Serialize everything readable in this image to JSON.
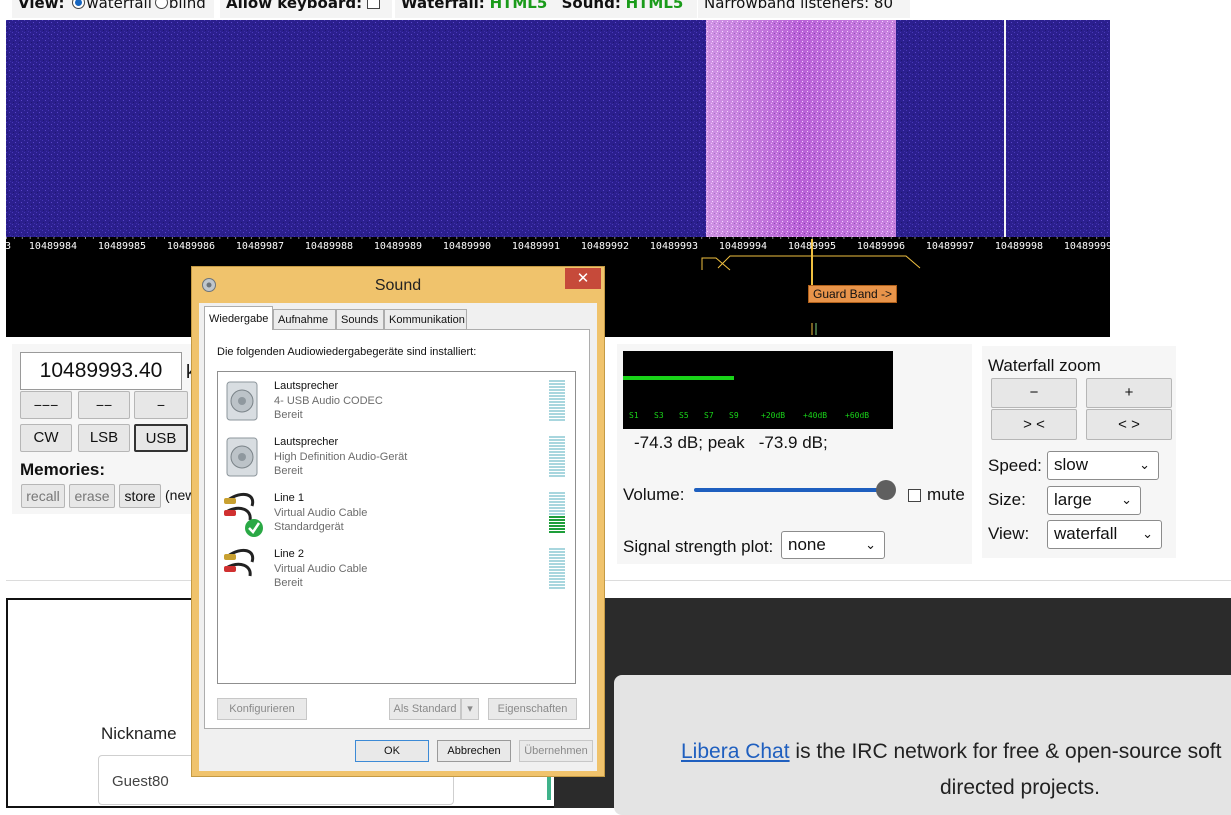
{
  "topbar": {
    "view_label": "View:",
    "view_opt1": "waterfall",
    "view_opt2": "blind",
    "keyboard_label": "Allow keyboard:",
    "waterfall_label": "Waterfall:",
    "waterfall_value": "HTML5",
    "sound_label": "Sound:",
    "sound_value": "HTML5",
    "listeners": "Narrowband listeners: 80"
  },
  "waterfall": {
    "ticks": [
      "3",
      "10489984",
      "10489985",
      "10489986",
      "10489987",
      "10489988",
      "10489989",
      "10489990",
      "10489991",
      "10489992",
      "10489993",
      "10489994",
      "10489995",
      "10489996",
      "10489997",
      "10489998",
      "10489999"
    ],
    "guard_band_label": "Guard Band ->",
    "colors": {
      "background": "#2a1f8c",
      "signal": "#c070e0",
      "ruler": "#000000",
      "marker": "#f0c040"
    }
  },
  "tuning": {
    "frequency": "10489993.40",
    "unit_fragment": "k",
    "step_buttons": [
      "−−−",
      "−−",
      "−"
    ],
    "mode_buttons": [
      "CW",
      "LSB",
      "USB"
    ],
    "memories_label": "Memories:",
    "memory_buttons": [
      "recall",
      "erase",
      "store"
    ],
    "memory_hint": "(new"
  },
  "audio": {
    "smeter_scale": [
      "S1",
      "S3",
      "S5",
      "S7",
      "S9",
      "+20dB",
      "+40dB",
      "+60dB"
    ],
    "signal_level": 0.37,
    "db_readout": "-74.3 dB; peak   -73.9 dB;",
    "volume_label": "Volume:",
    "volume_level": 0.96,
    "mute_label": "mute",
    "ssp_label": "Signal strength plot:",
    "ssp_value": "none"
  },
  "zoom": {
    "title": "Waterfall zoom",
    "buttons": [
      "−",
      "+",
      "> <",
      "< >"
    ],
    "speed_label": "Speed:",
    "speed_value": "slow",
    "size_label": "Size:",
    "size_value": "large",
    "view_label": "View:",
    "view_value": "waterfall"
  },
  "chat": {
    "nickname_label": "Nickname",
    "nickname_value": "Guest80",
    "libera_link": "Libera Chat",
    "libera_text1": " is the IRC network for free & open-source soft",
    "libera_text2": "directed projects."
  },
  "dialog": {
    "title": "Sound",
    "close": "✕",
    "tabs": [
      "Wiedergabe",
      "Aufnahme",
      "Sounds",
      "Kommunikation"
    ],
    "intro": "Die folgenden Audiowiedergabegeräte sind installiert:",
    "devices": [
      {
        "name": "Lautsprecher",
        "subtitle": "4- USB Audio CODEC",
        "status": "Bereit",
        "icon": "speaker-icon",
        "level": 0
      },
      {
        "name": "Lautsprecher",
        "subtitle": "High Definition Audio-Gerät",
        "status": "Bereit",
        "icon": "speaker-icon",
        "level": 0
      },
      {
        "name": "Line 1",
        "subtitle": "Virtual Audio Cable",
        "status": "Standardgerät",
        "icon": "audio-cable-icon",
        "level": 0.45
      },
      {
        "name": "Line 2",
        "subtitle": "Virtual Audio Cable",
        "status": "Bereit",
        "icon": "audio-cable-icon",
        "level": 0
      }
    ],
    "configure": "Konfigurieren",
    "set_default": "Als Standard",
    "properties": "Eigenschaften",
    "ok": "OK",
    "cancel": "Abbrechen",
    "apply": "Übernehmen"
  }
}
